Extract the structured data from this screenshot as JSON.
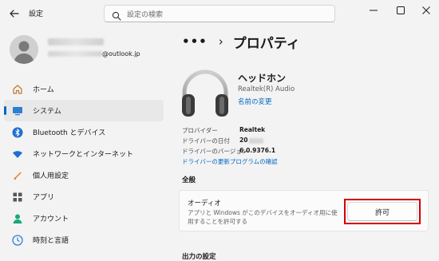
{
  "window": {
    "title": "設定",
    "controls": [
      "minimize-icon",
      "maximize-icon",
      "close-icon"
    ]
  },
  "search": {
    "placeholder": "設定の検索"
  },
  "account": {
    "email_suffix": "@outlook.jp"
  },
  "nav": {
    "items": [
      {
        "label": "ホーム",
        "icon": "home-icon",
        "active": false
      },
      {
        "label": "システム",
        "icon": "system-icon",
        "active": true
      },
      {
        "label": "Bluetooth とデバイス",
        "icon": "bluetooth-icon",
        "active": false
      },
      {
        "label": "ネットワークとインターネット",
        "icon": "wifi-icon",
        "active": false
      },
      {
        "label": "個人用設定",
        "icon": "personalize-icon",
        "active": false
      },
      {
        "label": "アプリ",
        "icon": "apps-icon",
        "active": false
      },
      {
        "label": "アカウント",
        "icon": "account-icon",
        "active": false
      },
      {
        "label": "時刻と言語",
        "icon": "time-language-icon",
        "active": false
      }
    ]
  },
  "breadcrumb": {
    "ellipsis": "•••",
    "separator": "›",
    "title": "プロパティ"
  },
  "device": {
    "name": "ヘッドホン",
    "subtitle": "Realtek(R) Audio",
    "rename_link": "名前の変更",
    "icon": "headphones-icon"
  },
  "driver_info": {
    "provider_label": "プロバイダー",
    "provider_value": "Realtek",
    "date_label": "ドライバーの日付",
    "date_value": "20",
    "version_label": "ドライバーのバージョン",
    "version_value": "6.0.9376.1",
    "update_link": "ドライバーの更新プログラムの確認"
  },
  "general": {
    "section_title": "全般",
    "audio_title": "オーディオ",
    "audio_desc": "アプリと Windows がこのデバイスをオーディオ用に使用することを許可する",
    "allow_button": "許可"
  },
  "output_settings": {
    "section_title": "出力の設定"
  },
  "colors": {
    "accent": "#0067c0",
    "highlight": "#d40000",
    "background": "#f3f3f3"
  }
}
